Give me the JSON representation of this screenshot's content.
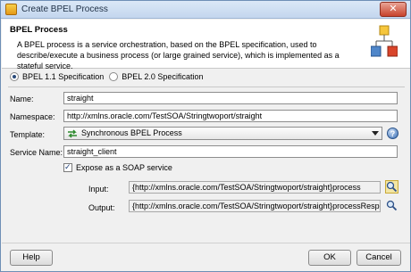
{
  "window": {
    "title": "Create BPEL Process",
    "close_glyph": "✕"
  },
  "header": {
    "title": "BPEL Process",
    "description": "A BPEL process is a service orchestration, based on the BPEL specification, used to describe/execute a business process (or large grained service), which is implemented as a stateful service."
  },
  "spec": {
    "options": [
      {
        "label": "BPEL 1.1 Specification",
        "selected": true
      },
      {
        "label": "BPEL 2.0 Specification",
        "selected": false
      }
    ]
  },
  "form": {
    "name_label": "Name:",
    "name_value": "straight",
    "namespace_label": "Namespace:",
    "namespace_value": "http://xmlns.oracle.com/TestSOA/Stringtwoport/straight",
    "template_label": "Template:",
    "template_value": "Synchronous BPEL Process",
    "service_name_label": "Service Name:",
    "service_name_value": "straight_client",
    "expose_soap_label": "Expose as a SOAP service",
    "expose_soap_checked": true,
    "input_label": "Input:",
    "input_value": "{http://xmlns.oracle.com/TestSOA/Stringtwoport/straight}process",
    "output_label": "Output:",
    "output_value": "{http://xmlns.oracle.com/TestSOA/Stringtwoport/straight}processResponse"
  },
  "buttons": {
    "help": "Help",
    "ok": "OK",
    "cancel": "Cancel"
  },
  "icons": {
    "title": "jdeveloper-app-icon",
    "header": "bpel-process-graphic",
    "template": "sync-process-icon",
    "help": "help-icon",
    "input_browse": "search-icon",
    "output_browse": "search-icon"
  },
  "colors": {
    "title_bar": "#c3d6ee",
    "close_button": "#c7432c",
    "header_bg": "#ffffff",
    "dialog_bg": "#f0f0f0"
  }
}
